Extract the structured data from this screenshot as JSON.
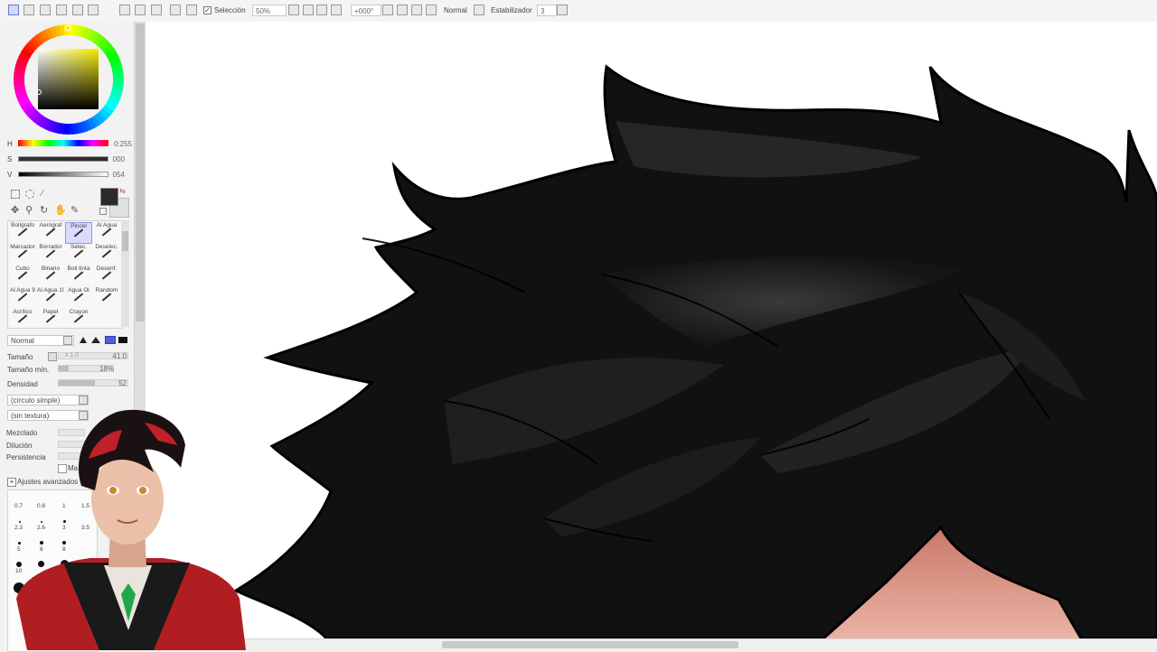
{
  "toolbar": {
    "selection_label": "Selección",
    "selection_checked": true,
    "zoom": "50%",
    "rotation": "+000°",
    "blend_mode": "Normal",
    "stabilizer_label": "Estabilizador",
    "stabilizer_value": "3"
  },
  "color": {
    "current_hex": "#2b2b2b",
    "h_label": "H",
    "h_value": "0:255",
    "s_label": "S",
    "s_value": "000",
    "v_label": "V",
    "v_value": "054"
  },
  "brushes": [
    {
      "label": "Bolígrafo"
    },
    {
      "label": "Aerógraf"
    },
    {
      "label": "Pincel",
      "selected": true
    },
    {
      "label": "Al Agua"
    },
    {
      "label": "Marcador"
    },
    {
      "label": "Borrador"
    },
    {
      "label": "Selec."
    },
    {
      "label": "Deselec."
    },
    {
      "label": "Cubo"
    },
    {
      "label": "Binario"
    },
    {
      "label": "Boli tinta"
    },
    {
      "label": "Desenf."
    },
    {
      "label": "Al Agua 9"
    },
    {
      "label": "Al Agua 10"
    },
    {
      "label": "Agua Ol"
    },
    {
      "label": "Random"
    },
    {
      "label": "Acrílico"
    },
    {
      "label": "Papel"
    },
    {
      "label": "Crayon"
    },
    {
      "label": ""
    }
  ],
  "brush_settings": {
    "blend_mode": "Normal",
    "size_label": "Tamaño",
    "size_multiplier": "x 1.0",
    "size_value": "41.0",
    "min_size_label": "Tamaño mín.",
    "min_size_value": "18%",
    "min_size_fraction": 0.18,
    "density_label": "Densidad",
    "density_value": "52",
    "density_fraction": 0.52,
    "shape": "(círculo simple)",
    "texture": "(sin textura)",
    "mix_label": "Mezclado",
    "dilution_label": "Dilución",
    "persistence_label": "Persistencia",
    "checkbox_partial": "Ma",
    "advanced_label": "Ajustes avanzados"
  },
  "brush_size_presets": {
    "row1": [
      "0.7",
      "0.8",
      "1",
      "1.5"
    ],
    "row2": [
      "2.3",
      "2.6",
      "3",
      "3.5"
    ],
    "row3": [
      "5",
      "6",
      "8"
    ],
    "row4": [
      "10"
    ]
  }
}
